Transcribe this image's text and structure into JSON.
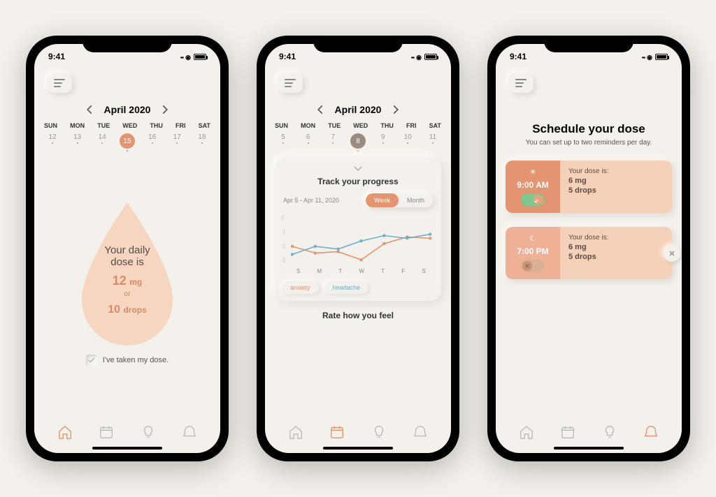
{
  "status": {
    "time": "9:41"
  },
  "calendar": {
    "month_label": "April 2020",
    "day_names": [
      "SUN",
      "MON",
      "TUE",
      "WED",
      "THU",
      "FRI",
      "SAT"
    ]
  },
  "screen1": {
    "dates": [
      "12",
      "13",
      "14",
      "15",
      "16",
      "17",
      "18"
    ],
    "selected_index": 3,
    "selected_color": "#e39470",
    "dose_line1": "Your daily",
    "dose_line2": "dose is",
    "dose_amount": "12",
    "dose_unit": "mg",
    "dose_or": "or",
    "dose_drops": "10",
    "dose_drops_label": "drops",
    "taken_label": "I've taken my dose."
  },
  "screen2": {
    "dates": [
      "5",
      "6",
      "7",
      "8",
      "9",
      "10",
      "11"
    ],
    "selected_index": 3,
    "selected_color": "#9b8a80",
    "card_title": "Track your progress",
    "range": "Apr 5 - Apr 11, 2020",
    "toggle": {
      "week": "Week",
      "month": "Month",
      "active": "week"
    },
    "x_labels": [
      "S",
      "M",
      "T",
      "W",
      "T",
      "F",
      "S"
    ],
    "tags": [
      "anxiety",
      "headache"
    ],
    "rate_title": "Rate how you feel"
  },
  "screen3": {
    "title": "Schedule your dose",
    "subtitle": "You can set up to two reminders per day.",
    "reminders": [
      {
        "icon": "sun",
        "time": "9:00 AM",
        "on": true,
        "label": "Your dose is:",
        "dose": "6 mg",
        "drops": "5 drops"
      },
      {
        "icon": "moon",
        "time": "7:00 PM",
        "on": false,
        "label": "Your dose is:",
        "dose": "6 mg",
        "drops": "5 drops"
      }
    ]
  },
  "chart_data": {
    "type": "line",
    "title": "Track your progress",
    "xlabel": "",
    "ylabel": "",
    "x": [
      "S",
      "M",
      "T",
      "W",
      "T",
      "F",
      "S"
    ],
    "y_scale": [
      "happy",
      "neutral",
      "unhappy",
      "sad"
    ],
    "ylim": [
      0,
      3
    ],
    "series": [
      {
        "name": "anxiety",
        "color": "#e39470",
        "values": [
          1.4,
          0.9,
          1.0,
          0.4,
          1.6,
          2.1,
          2.0
        ]
      },
      {
        "name": "headache",
        "color": "#6bb0cc",
        "values": [
          0.8,
          1.4,
          1.2,
          1.8,
          2.2,
          2.0,
          2.3
        ]
      }
    ],
    "range_label": "Apr 5 - Apr 11, 2020"
  }
}
